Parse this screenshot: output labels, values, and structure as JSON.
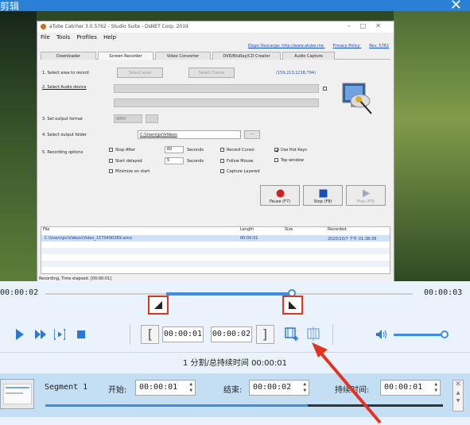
{
  "window": {
    "title": "剪辑",
    "close_icon": "close-icon"
  },
  "recorder_app": {
    "title": "aTube Catcher 3.0.5762 - Studio Suite - DsNET Corp. 2019",
    "menu": [
      "File",
      "Tools",
      "Profiles",
      "Help"
    ],
    "links": [
      "Dispo Descarga: http://www.atube.me",
      "Privacy Policy",
      "Rev. 5762"
    ],
    "tabs": [
      "Downloader",
      "Screen Recorder",
      "Video Converter",
      "DVD/BluRay/CD Creator",
      "Audio Capture"
    ],
    "active_tab": "Screen Recorder",
    "step1": "1. Select area to record",
    "select_area_button": "Select area",
    "select_frame_button": "Select Frame",
    "area_coords": "(159,213,1218,794)",
    "step2": "2. Select Audio device",
    "step3": "3. Set output format",
    "format_value": "WMV",
    "step4": "4. Select output folder",
    "folder_value": "C:\\Users\\pc\\Videos",
    "browse_label": "...",
    "step5": "5. Recording options",
    "stop_after": "Stop After",
    "stop_after_value": "60",
    "seconds1": "Seconds",
    "start_delayed": "Start delayed",
    "start_delayed_value": "5",
    "seconds2": "Seconds",
    "minimize_on_start": "Minimize on start",
    "record_cursor": "Record Cursor",
    "follow_mouse": "Follow Mouse",
    "capture_layered": "Capture Layered",
    "use_hot_keys": "Use Hot Keys",
    "top_window": "Top window",
    "pause_label": "Pause (F7)",
    "stop_label": "Stop (F8)",
    "play_label": "Play (F9)",
    "list_headers": {
      "file": "File",
      "length": "Length",
      "size": "Size",
      "recorded": "Recorded"
    },
    "list_row": {
      "file": "C:\\Users\\pc\\Videos\\Video_1570490289.wmv",
      "length": "00:00:01",
      "size": "",
      "recorded": "2020/10/7 下午 01:38:39"
    },
    "status": "Recording, Time elapsed: [00:00:01]"
  },
  "timeline": {
    "start_time": "00:00:02",
    "end_time": "00:00:03",
    "start_marker_icon": "start-marker-icon",
    "end_marker_icon": "end-marker-icon",
    "selection_start_fraction": 0.33,
    "selection_end_fraction": 0.67,
    "playhead_fraction": 0.67
  },
  "controls": {
    "play_icon": "play-icon",
    "fast_forward_icon": "fast-forward-icon",
    "play_selection_icon": "play-selection-icon",
    "stop_icon": "stop-icon",
    "set_start_bracket": "[",
    "set_end_bracket": "]",
    "start_time": "00:00:01",
    "end_time": "00:00:02",
    "add_segment_icon": "add-segment-icon",
    "split_segment_icon": "split-segment-icon",
    "volume_icon": "volume-icon",
    "volume_level": 1.0
  },
  "info": "1 分割/总持续时间 00:00:01",
  "segment": {
    "name": "Segment 1",
    "start_label": "开始:",
    "start_value": "00:00:01",
    "end_label": "结束:",
    "end_value": "00:00:02",
    "duration_label": "持续时间:",
    "duration_value": "00:00:01",
    "progress_start_fraction": 0.0,
    "progress_end_fraction": 0.66
  },
  "colors": {
    "accent": "#3a8ee6",
    "highlight": "#e53322",
    "titlebar": "#2b7fd4",
    "segment_bg": "#c4def3"
  }
}
